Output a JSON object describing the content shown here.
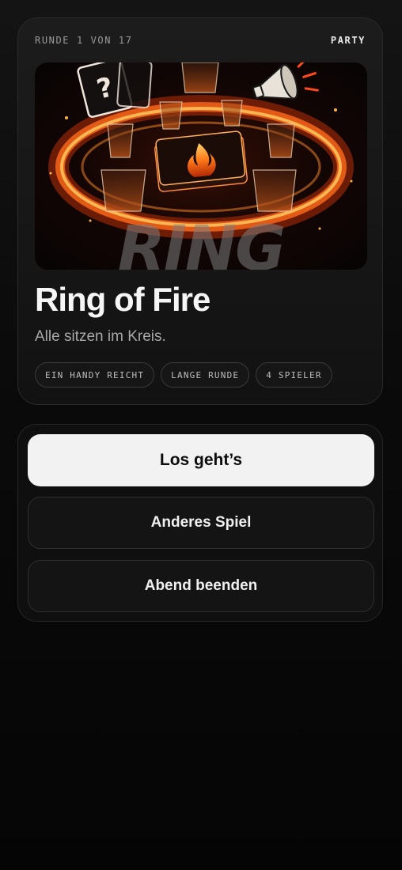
{
  "header": {
    "round_counter": "RUNDE 1 VON 17",
    "category": "PARTY"
  },
  "game": {
    "image_lettering": "RING",
    "title": "Ring of Fire",
    "subtitle": "Alle sitzen im Kreis.",
    "tags": [
      "EIN HANDY REICHT",
      "LANGE RUNDE",
      "4 SPIELER"
    ]
  },
  "actions": {
    "start_label": "Los geht’s",
    "other_game_label": "Anderes Spiel",
    "end_evening_label": "Abend beenden"
  },
  "colors": {
    "background": "#0b0b0b",
    "primary_button": "#f2f2f2",
    "fire_accent": "#ff6a1a"
  }
}
